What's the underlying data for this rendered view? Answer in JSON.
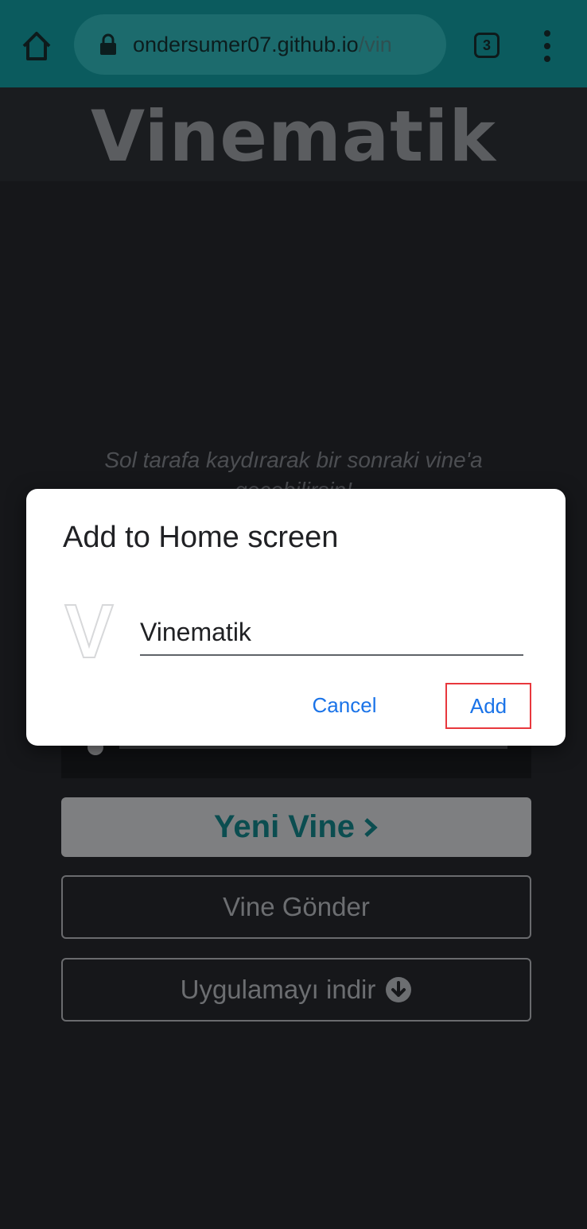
{
  "browser": {
    "url_host": "ondersumer07.github.io",
    "url_path": "/vin",
    "tab_count": "3",
    "home_icon": "home-icon",
    "lock_icon": "lock-icon",
    "menu_icon": "more-vert-icon"
  },
  "page": {
    "title": "Vinematik",
    "hint": "Sol tarafa kaydırarak bir sonraki vine'a geçebilirsin!",
    "new_vine_label": "Yeni Vine",
    "send_vine_label": "Vine Gönder",
    "download_label": "Uygulamayı indir",
    "accent_color": "#0b5b5e"
  },
  "dialog": {
    "title": "Add to Home screen",
    "app_name": "Vinematik",
    "cancel_label": "Cancel",
    "add_label": "Add",
    "button_color": "#1a73e8",
    "highlight_color": "#e8383d"
  }
}
